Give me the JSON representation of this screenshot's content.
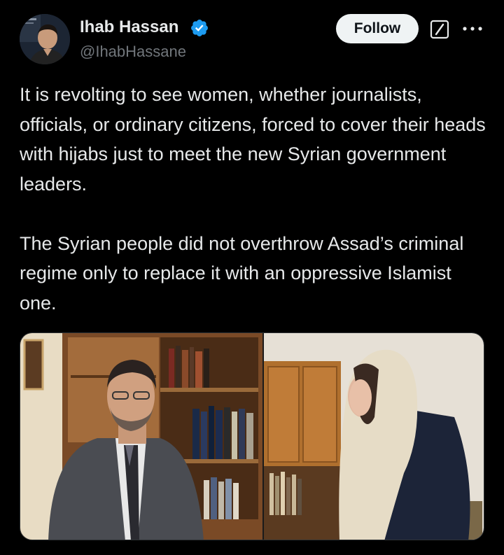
{
  "author": {
    "display_name": "Ihab Hassan",
    "handle": "@IhabHassane",
    "verified": true
  },
  "actions": {
    "follow_label": "Follow",
    "grok_icon": "grok-icon",
    "more_icon": "more-dots-icon"
  },
  "tweet": {
    "paragraphs": [
      "It is revolting to see women, whether journalists, officials, or ordinary citizens, forced to cover their heads with hijabs just to meet the new Syrian government leaders.",
      "The Syrian people did not overthrow Assad’s criminal regime only to replace it with an oppressive Islamist one."
    ]
  },
  "colors": {
    "background": "#000000",
    "text_primary": "#e7e9ea",
    "text_secondary": "#71767b",
    "verified_blue": "#1d9bf0",
    "follow_bg": "#eff3f4"
  }
}
